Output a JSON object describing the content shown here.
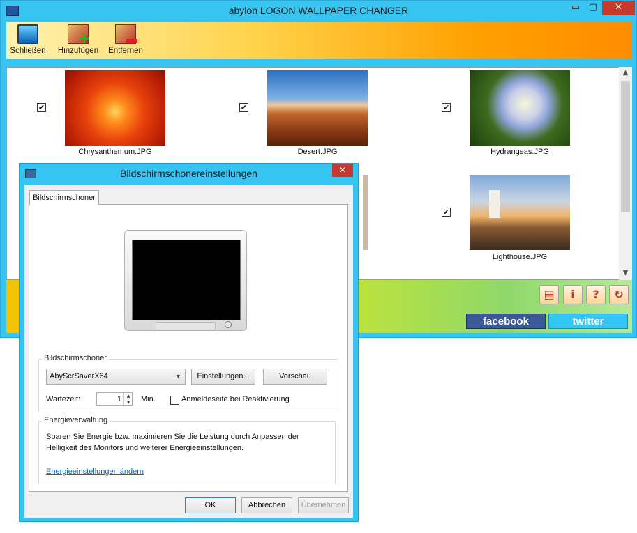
{
  "app": {
    "title": "abylon LOGON WALLPAPER CHANGER",
    "window_controls": {
      "minimize": "▭",
      "maximize": "▢",
      "close": "✕"
    }
  },
  "toolbar": {
    "items": [
      {
        "label": "Schließen",
        "icon": "monitor-icon"
      },
      {
        "label": "Hinzufügen",
        "icon": "add-image-icon"
      },
      {
        "label": "Entfernen",
        "icon": "remove-image-icon"
      }
    ]
  },
  "gallery": {
    "items": [
      {
        "caption": "Chrysanthemum.JPG",
        "checked": true
      },
      {
        "caption": "Desert.JPG",
        "checked": true
      },
      {
        "caption": "Hydrangeas.JPG",
        "checked": true
      },
      {
        "caption": "Lighthouse.JPG",
        "checked": true
      }
    ],
    "check_glyph": "✔"
  },
  "social": {
    "facebook": "facebook",
    "twitter": "twitter"
  },
  "dialog": {
    "title": "Bildschirmschonereinstellungen",
    "close_glyph": "✕",
    "tab": "Bildschirmschoner",
    "screensaver_group": {
      "legend": "Bildschirmschoner",
      "selected": "AbyScrSaverX64",
      "settings_button": "Einstellungen...",
      "preview_button": "Vorschau",
      "wait_label": "Wartezeit:",
      "wait_value": "1",
      "min_label": "Min.",
      "resume_checkbox_label": "Anmeldeseite bei Reaktivierung",
      "resume_checked": false
    },
    "energy_group": {
      "legend": "Energieverwaltung",
      "line1": "Sparen Sie Energie bzw. maximieren Sie die Leistung durch Anpassen der",
      "line2": "Helligkeit des Monitors und weiterer Energieeinstellungen.",
      "link": "Energieeinstellungen ändern"
    },
    "buttons": {
      "ok": "OK",
      "cancel": "Abbrechen",
      "apply": "Übernehmen"
    }
  }
}
